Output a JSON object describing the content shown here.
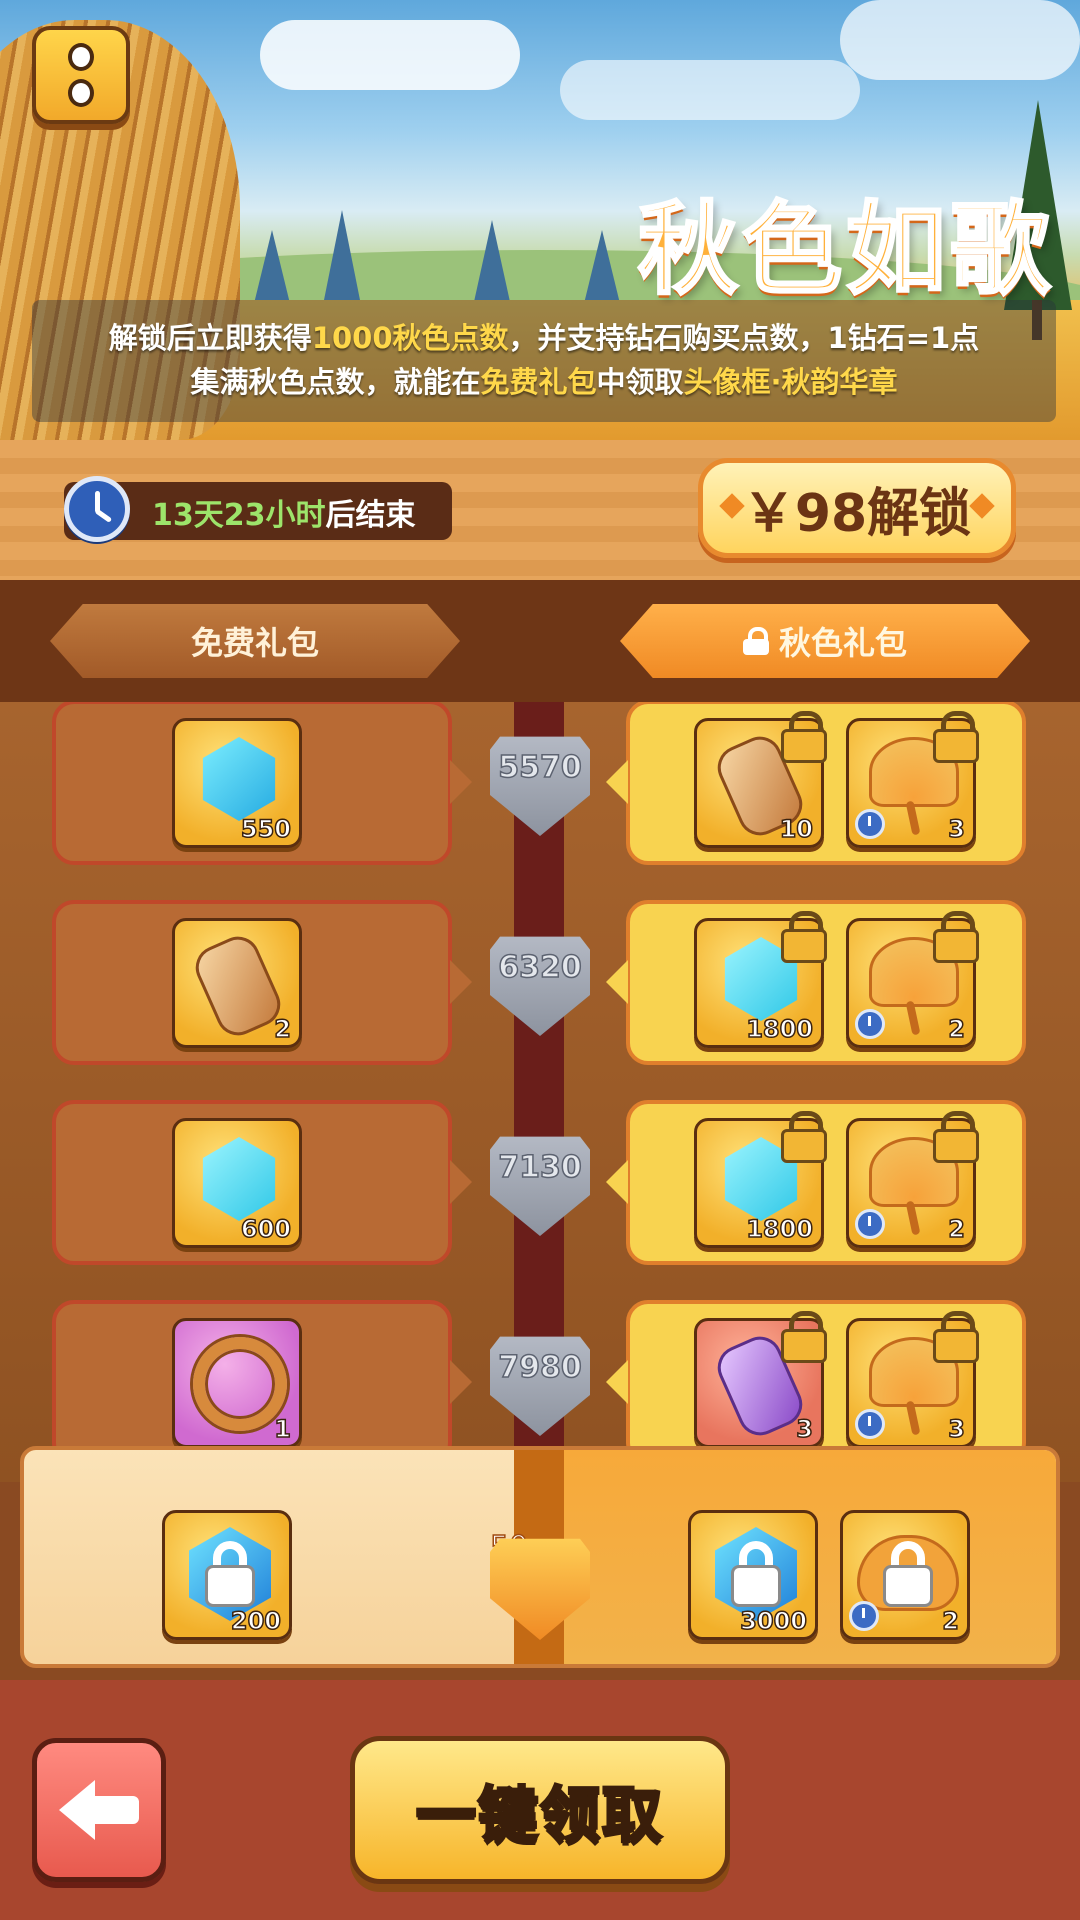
{
  "banner": {
    "title": "秋色如歌",
    "info_line1": {
      "pre": "解锁后立即获得",
      "hl": "1000秋色点数",
      "post": "，并支持钻石购买点数，1钻石=1点"
    },
    "info_line2": {
      "pre": "集满秋色点数，就能在",
      "hl1": "免费礼包",
      "mid": "中领取",
      "hl2": "头像框·秋韵华章"
    }
  },
  "timer": {
    "time_left": "13天23小时",
    "suffix": "后结束"
  },
  "unlock_button": {
    "label": "￥98解锁"
  },
  "tabs": {
    "free": "免费礼包",
    "premium": "秋色礼包"
  },
  "rows": [
    {
      "points": "5570",
      "free": {
        "icon": "blue-gem-icon",
        "qty": "550"
      },
      "premium": [
        {
          "icon": "scroll-icon",
          "qty": "10",
          "locked": true
        },
        {
          "icon": "ginkgo-leaf-icon",
          "qty": "3",
          "locked": true,
          "timed": true
        }
      ]
    },
    {
      "points": "6320",
      "free": {
        "icon": "scroll-icon",
        "qty": "2"
      },
      "premium": [
        {
          "icon": "cyan-gem-icon",
          "qty": "1800",
          "locked": true
        },
        {
          "icon": "ginkgo-leaf-icon",
          "qty": "2",
          "locked": true,
          "timed": true
        }
      ]
    },
    {
      "points": "7130",
      "free": {
        "icon": "cyan-gem-icon",
        "qty": "600"
      },
      "premium": [
        {
          "icon": "cyan-gem-icon",
          "qty": "1800",
          "locked": true
        },
        {
          "icon": "ginkgo-leaf-icon",
          "qty": "2",
          "locked": true,
          "timed": true
        }
      ]
    },
    {
      "points": "7980",
      "free": {
        "icon": "autumn-wreath-frame-icon",
        "qty": "1"
      },
      "premium": [
        {
          "icon": "purple-scroll-icon",
          "qty": "3",
          "locked": true
        },
        {
          "icon": "ginkgo-leaf-icon",
          "qty": "3",
          "locked": true,
          "timed": true
        }
      ]
    }
  ],
  "final_row": {
    "level": "50",
    "free": {
      "icon": "locked-gem-icon",
      "qty": "200"
    },
    "premium": [
      {
        "icon": "locked-gem-icon",
        "qty": "3000"
      },
      {
        "icon": "locked-leaf-icon",
        "qty": "2",
        "timed": true
      }
    ]
  },
  "footer": {
    "claim_all": "一键领取"
  },
  "colors": {
    "accent_orange": "#f08a24",
    "highlight_yellow": "#ffd84a",
    "timer_green": "#9de46a",
    "premium_card": "#f8d350",
    "free_card": "#b86a34"
  }
}
